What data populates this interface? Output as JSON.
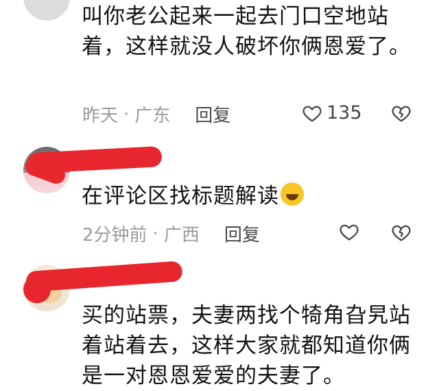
{
  "comments": [
    {
      "text": "叫你老公起来一起去门口空地站着，这样就没人破坏你俩恩爱了。",
      "time": "昨天",
      "separator": "·",
      "location": "广东",
      "reply_label": "回复",
      "like_count": "135"
    },
    {
      "text": "在评论区找标题解读",
      "emoji": "laughing-crying-emoji",
      "time": "2分钟前",
      "separator": "·",
      "location": "广西",
      "reply_label": "回复",
      "like_count": ""
    },
    {
      "text": "买的站票，夫妻两找个犄角旮旯站着站着去，这样大家就都知道你俩是一对恩恩爱爱的夫妻了。",
      "time": "",
      "location": "",
      "reply_label": "",
      "like_count": ""
    }
  ],
  "colors": {
    "redaction": "#e8262d",
    "meta_text": "#9a9a9a"
  }
}
